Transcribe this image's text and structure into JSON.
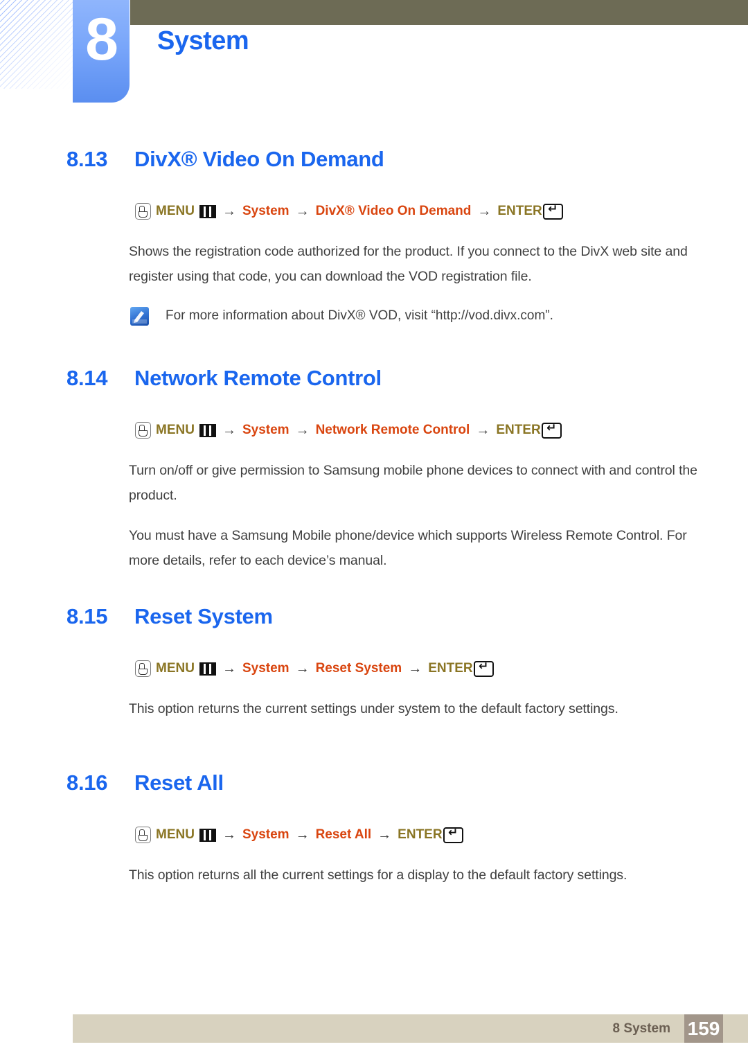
{
  "chapter": {
    "number": "8",
    "title": "System"
  },
  "icons": {
    "hand": "hand-press-icon",
    "menu_grid": "menu-grid-icon",
    "enter": "enter-return-icon",
    "note": "note-pencil-icon"
  },
  "colors": {
    "heading_blue": "#1a66ee",
    "menu_olive": "#8a7524",
    "menu_orange": "#d9450f",
    "header_olive_bar": "#6d6b55",
    "footer_beige": "#d8d2bf",
    "footer_page_box": "#a2968a"
  },
  "sections": [
    {
      "number": "8.13",
      "name": "DivX® Video On Demand",
      "menu_path": {
        "menu_label": "MENU",
        "step1": "System",
        "step2": "DivX® Video On Demand",
        "enter_label": "ENTER"
      },
      "paragraphs": [
        "Shows the registration code authorized for the product. If you connect to the DivX web site and register using that code, you can download the VOD registration file."
      ],
      "note": "For more information about DivX® VOD, visit “http://vod.divx.com”."
    },
    {
      "number": "8.14",
      "name": "Network Remote Control",
      "menu_path": {
        "menu_label": "MENU",
        "step1": "System",
        "step2": "Network Remote Control",
        "enter_label": "ENTER"
      },
      "paragraphs": [
        "Turn on/off or give permission to Samsung mobile phone devices to connect with and control the product.",
        "You must have a Samsung Mobile phone/device which supports Wireless Remote Control. For more details, refer to each device’s manual."
      ]
    },
    {
      "number": "8.15",
      "name": "Reset System",
      "menu_path": {
        "menu_label": "MENU",
        "step1": "System",
        "step2": "Reset System",
        "enter_label": "ENTER"
      },
      "paragraphs": [
        "This option returns the current settings under system to the default factory settings."
      ]
    },
    {
      "number": "8.16",
      "name": "Reset All",
      "menu_path": {
        "menu_label": "MENU",
        "step1": "System",
        "step2": "Reset All",
        "enter_label": "ENTER"
      },
      "paragraphs": [
        "This option returns all the current settings for a display to the default factory settings."
      ]
    }
  ],
  "footer": {
    "label": "8 System",
    "page": "159"
  },
  "arrow_glyph": "→"
}
